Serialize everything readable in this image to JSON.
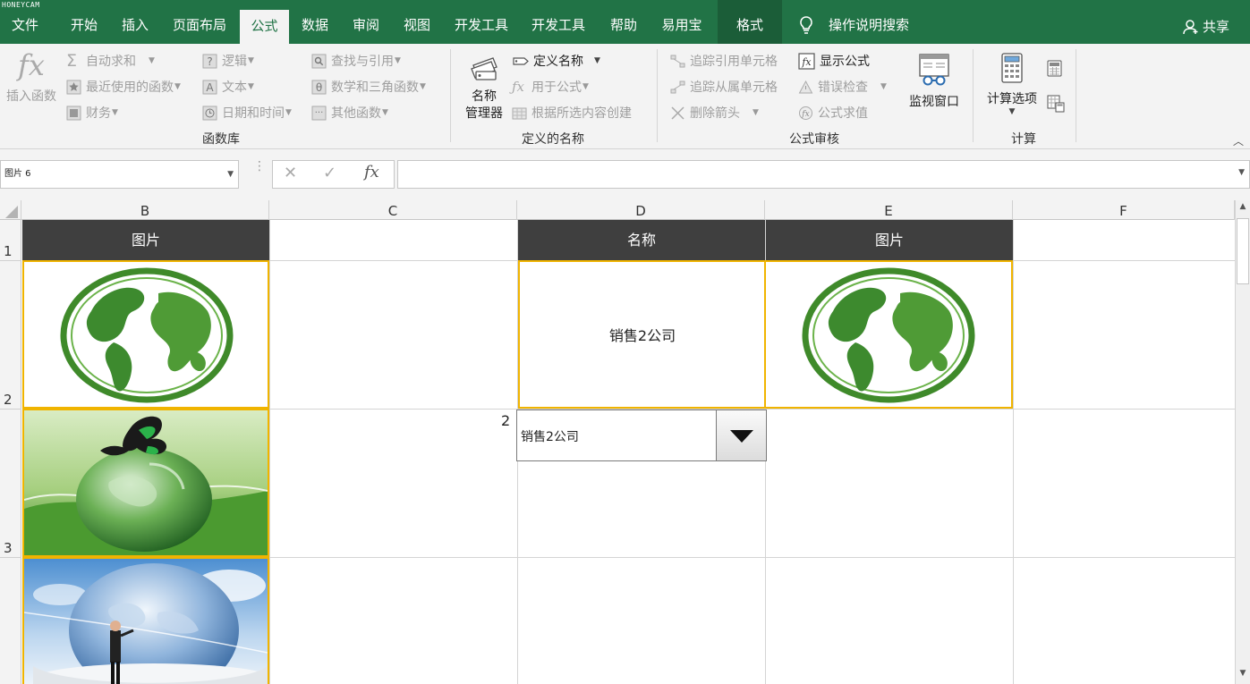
{
  "watermark": "HONEYCAM",
  "tabs": [
    "文件",
    "开始",
    "插入",
    "页面布局",
    "公式",
    "数据",
    "审阅",
    "视图",
    "开发工具",
    "开发工具",
    "帮助",
    "易用宝",
    "格式"
  ],
  "tell_me": "操作说明搜索",
  "share": "共享",
  "ribbon": {
    "insert_function": "插入函数",
    "autosum": "自动求和",
    "recent": "最近使用的函数",
    "financial": "财务",
    "logical": "逻辑",
    "text": "文本",
    "datetime": "日期和时间",
    "lookup": "查找与引用",
    "math": "数学和三角函数",
    "more": "其他函数",
    "group_library": "函数库",
    "name_manager_1": "名称",
    "name_manager_2": "管理器",
    "define_name": "定义名称",
    "use_in_formula": "用于公式",
    "create_from_selection": "根据所选内容创建",
    "group_names": "定义的名称",
    "trace_precedents": "追踪引用单元格",
    "trace_dependents": "追踪从属单元格",
    "remove_arrows": "删除箭头",
    "show_formulas": "显示公式",
    "error_checking": "错误检查",
    "evaluate_formula": "公式求值",
    "watch_window": "监视窗口",
    "group_auditing": "公式审核",
    "calc_options": "计算选项",
    "group_calc": "计算"
  },
  "name_box": "图片 6",
  "formula_value": "",
  "columns": [
    "B",
    "C",
    "D",
    "E",
    "F"
  ],
  "rows": [
    "1",
    "2",
    "3"
  ],
  "cells": {
    "b1": "图片",
    "d1": "名称",
    "e1": "图片",
    "d2": "销售2公司",
    "c3": "2"
  },
  "combo": {
    "value": "销售2公司"
  },
  "images": [
    "green-globe-grass",
    "green-globe-butterfly",
    "blue-globe-businessman",
    "green-globe-grass"
  ],
  "colors": {
    "accent": "#217346",
    "header_fill": "#3f3f3f",
    "selection": "#f0b400"
  }
}
